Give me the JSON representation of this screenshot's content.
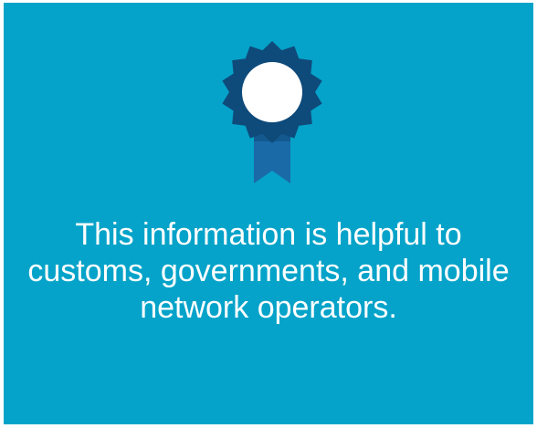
{
  "card": {
    "background_color": "#05a3c9",
    "badge_icon": "award-ribbon-icon",
    "badge_colors": {
      "seal": "#0e4a7a",
      "ribbon": "#1a6aa8",
      "center": "#ffffff"
    },
    "message": "This information is helpful to customs, governments, and mobile network operators."
  }
}
